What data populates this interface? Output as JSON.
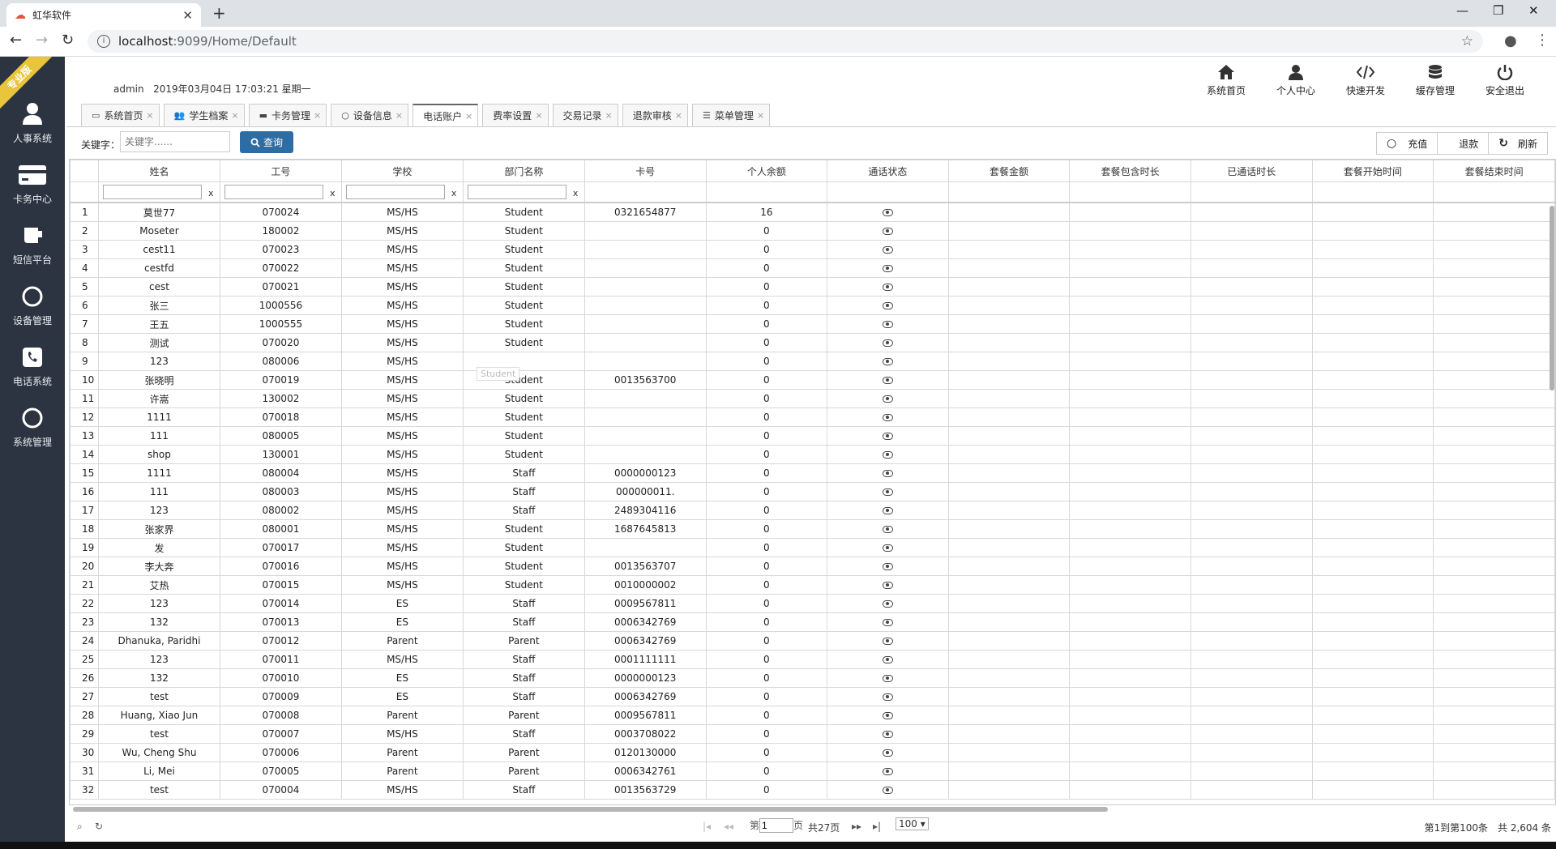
{
  "browser": {
    "tab_title": "虹华软件",
    "url_host": "localhost",
    "url_rest": ":9099/Home/Default",
    "new_tab": "+",
    "min": "—",
    "restore": "❐",
    "close": "✕"
  },
  "ribbon": "专业版",
  "sidebar": {
    "items": [
      {
        "label": "人事系统",
        "icon": "person-icon"
      },
      {
        "label": "卡务中心",
        "icon": "card-icon"
      },
      {
        "label": "短信平台",
        "icon": "cup-icon"
      },
      {
        "label": "设备管理",
        "icon": "circle-icon"
      },
      {
        "label": "电话系统",
        "icon": "phone-icon"
      },
      {
        "label": "系统管理",
        "icon": "circle-icon"
      }
    ]
  },
  "header": {
    "user": "admin",
    "datetime": "2019年03月04日 17:03:21 星期一"
  },
  "topnav": [
    {
      "label": "系统首页",
      "icon": "home-icon"
    },
    {
      "label": "个人中心",
      "icon": "user-icon"
    },
    {
      "label": "快速开发",
      "icon": "code-icon"
    },
    {
      "label": "缓存管理",
      "icon": "database-icon"
    },
    {
      "label": "安全退出",
      "icon": "power-icon"
    }
  ],
  "tabs": [
    {
      "label": "系统首页",
      "icon": "monitor-icon"
    },
    {
      "label": "学生档案",
      "icon": "users-icon"
    },
    {
      "label": "卡务管理",
      "icon": "card-icon"
    },
    {
      "label": "设备信息",
      "icon": "circle-icon"
    },
    {
      "label": "电话账户",
      "icon": "",
      "active": true
    },
    {
      "label": "费率设置",
      "icon": ""
    },
    {
      "label": "交易记录",
      "icon": ""
    },
    {
      "label": "退款审核",
      "icon": ""
    },
    {
      "label": "菜单管理",
      "icon": "list-icon"
    }
  ],
  "toolbar": {
    "keyword_label": "关键字：",
    "keyword_placeholder": "关键字......",
    "search_label": "查询",
    "recharge_label": "充值",
    "refund_label": "退款",
    "refresh_label": "刷新"
  },
  "grid": {
    "columns": [
      "",
      "姓名",
      "工号",
      "学校",
      "部门名称",
      "卡号",
      "个人余额",
      "通话状态",
      "套餐金额",
      "套餐包含时长",
      "已通话时长",
      "套餐开始时间",
      "套餐结束时间"
    ],
    "filter_clear": "x",
    "rows": [
      [
        "1",
        "莫世77",
        "070024",
        "MS/HS",
        "Student",
        "0321654877",
        "16"
      ],
      [
        "2",
        "Moseter",
        "180002",
        "MS/HS",
        "Student",
        "",
        "0"
      ],
      [
        "3",
        "cest11",
        "070023",
        "MS/HS",
        "Student",
        "",
        "0"
      ],
      [
        "4",
        "cestfd",
        "070022",
        "MS/HS",
        "Student",
        "",
        "0"
      ],
      [
        "5",
        "cest",
        "070021",
        "MS/HS",
        "Student",
        "",
        "0"
      ],
      [
        "6",
        "张三",
        "1000556",
        "MS/HS",
        "Student",
        "",
        "0"
      ],
      [
        "7",
        "王五",
        "1000555",
        "MS/HS",
        "Student",
        "",
        "0"
      ],
      [
        "8",
        "测试",
        "070020",
        "MS/HS",
        "Student",
        "",
        "0"
      ],
      [
        "9",
        "123",
        "080006",
        "MS/HS",
        "",
        "",
        "0"
      ],
      [
        "10",
        "张晓明",
        "070019",
        "MS/HS",
        "Student",
        "0013563700",
        "0"
      ],
      [
        "11",
        "许嵩",
        "130002",
        "MS/HS",
        "Student",
        "",
        "0"
      ],
      [
        "12",
        "1111",
        "070018",
        "MS/HS",
        "Student",
        "",
        "0"
      ],
      [
        "13",
        "111",
        "080005",
        "MS/HS",
        "Student",
        "",
        "0"
      ],
      [
        "14",
        "shop",
        "130001",
        "MS/HS",
        "Student",
        "",
        "0"
      ],
      [
        "15",
        "1111",
        "080004",
        "MS/HS",
        "Staff",
        "0000000123",
        "0"
      ],
      [
        "16",
        "111",
        "080003",
        "MS/HS",
        "Staff",
        "000000011.",
        "0"
      ],
      [
        "17",
        "123",
        "080002",
        "MS/HS",
        "Staff",
        "2489304116",
        "0"
      ],
      [
        "18",
        "张家界",
        "080001",
        "MS/HS",
        "Student",
        "1687645813",
        "0"
      ],
      [
        "19",
        "发",
        "070017",
        "MS/HS",
        "Student",
        "",
        "0"
      ],
      [
        "20",
        "李大奔",
        "070016",
        "MS/HS",
        "Student",
        "0013563707",
        "0"
      ],
      [
        "21",
        "艾热",
        "070015",
        "MS/HS",
        "Student",
        "0010000002",
        "0"
      ],
      [
        "22",
        "123",
        "070014",
        "ES",
        "Staff",
        "0009567811",
        "0"
      ],
      [
        "23",
        "132",
        "070013",
        "ES",
        "Staff",
        "0006342769",
        "0"
      ],
      [
        "24",
        "Dhanuka, Paridhi",
        "070012",
        "Parent",
        "Parent",
        "0006342769",
        "0"
      ],
      [
        "25",
        "123",
        "070011",
        "MS/HS",
        "Staff",
        "0001111111",
        "0"
      ],
      [
        "26",
        "132",
        "070010",
        "ES",
        "Staff",
        "0000000123",
        "0"
      ],
      [
        "27",
        "test",
        "070009",
        "ES",
        "Staff",
        "0006342769",
        "0"
      ],
      [
        "28",
        "Huang, Xiao Jun",
        "070008",
        "Parent",
        "Parent",
        "0009567811",
        "0"
      ],
      [
        "29",
        "test",
        "070007",
        "MS/HS",
        "Staff",
        "0003708022",
        "0"
      ],
      [
        "30",
        "Wu, Cheng Shu",
        "070006",
        "Parent",
        "Parent",
        "0120130000",
        "0"
      ],
      [
        "31",
        "Li, Mei",
        "070005",
        "Parent",
        "Parent",
        "0006342761",
        "0"
      ],
      [
        "32",
        "test",
        "070004",
        "MS/HS",
        "Staff",
        "0013563729",
        "0"
      ]
    ]
  },
  "tooltip": "Student",
  "pager": {
    "page_prefix": "第",
    "page_value": "1",
    "page_suffix": "页",
    "total_pages": "共27页",
    "page_size": "100",
    "summary": "第1到第100条　共 2,604 条"
  }
}
